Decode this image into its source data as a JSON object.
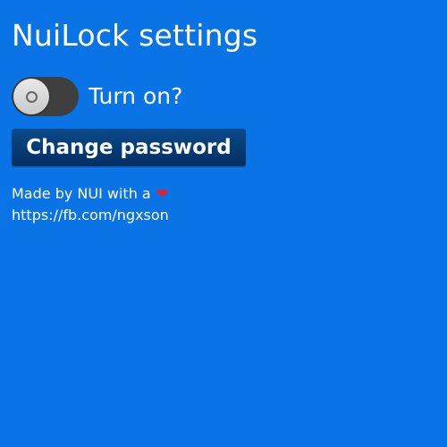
{
  "page": {
    "title": "NuiLock settings",
    "background_color": "#0a74e6"
  },
  "toggle": {
    "label": "Turn on?",
    "state": "off"
  },
  "change_password": {
    "label": "Change password"
  },
  "footer": {
    "credit_text": "Made by NUI with a",
    "heart_icon": "heart-icon",
    "heart_color": "#e0242c",
    "link": "https://fb.com/ngxson"
  }
}
